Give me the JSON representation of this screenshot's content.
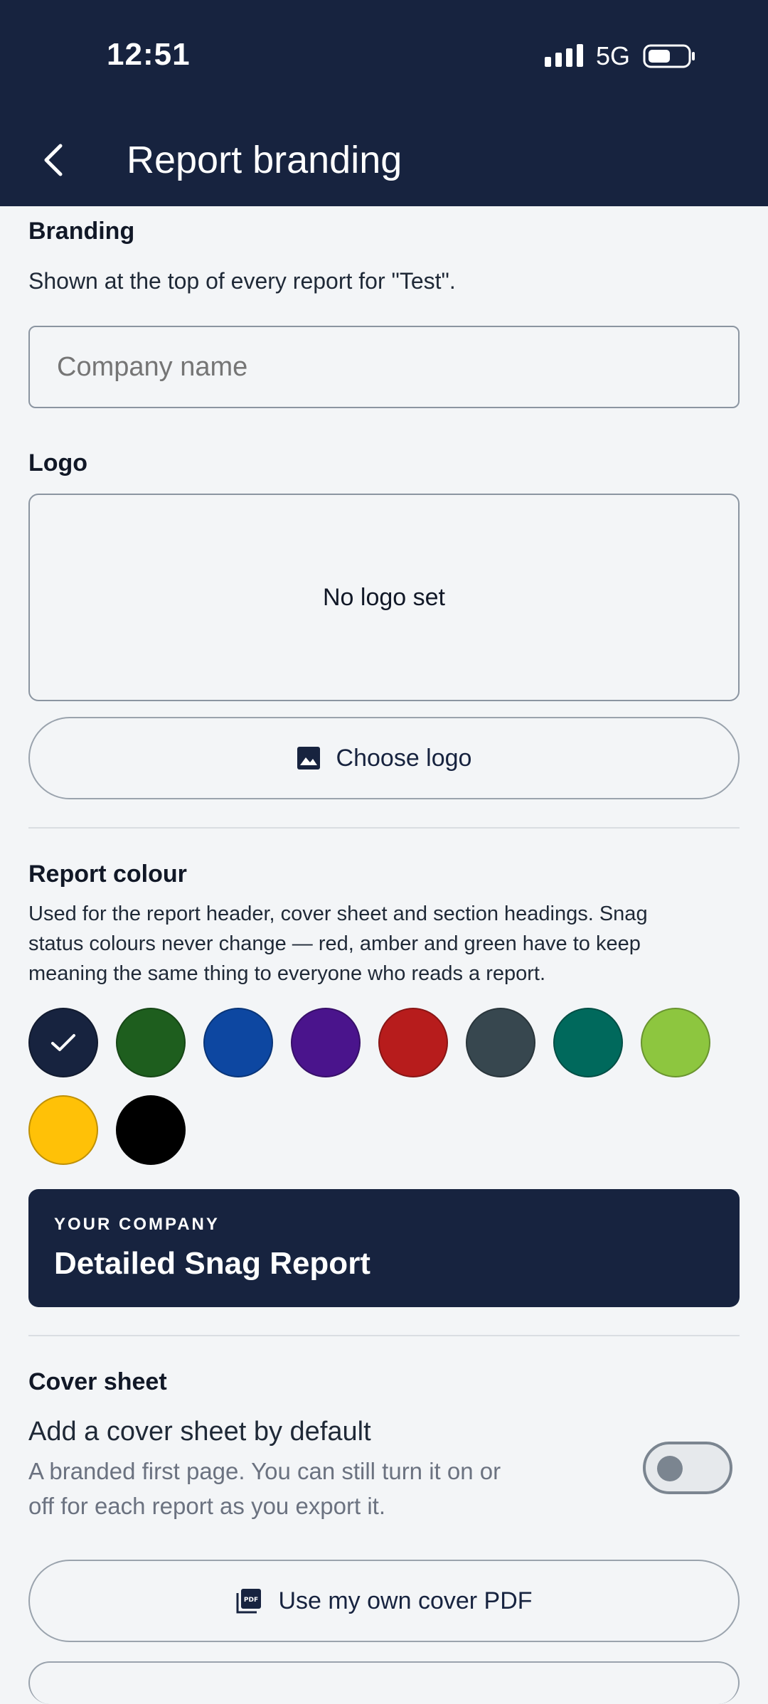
{
  "status": {
    "time": "12:51",
    "network": "5G"
  },
  "header": {
    "title": "Report branding"
  },
  "branding": {
    "heading": "Branding",
    "description": "Shown at the top of every report for \"Test\".",
    "company_placeholder": "Company name"
  },
  "logo": {
    "heading": "Logo",
    "empty_text": "No logo set",
    "choose_label": "Choose logo"
  },
  "colour": {
    "heading": "Report colour",
    "description_lines": [
      "Used for the report header, cover sheet and section headings. Snag",
      "status colours never change — red, amber and green have to keep",
      "meaning the same thing to everyone who reads a report."
    ],
    "swatches": [
      "#17233f",
      "#1e5e1e",
      "#0d47a1",
      "#4a148c",
      "#b71c1c",
      "#37474f",
      "#00695c",
      "#8dc63f",
      "#ffc107",
      "#000000"
    ],
    "selected": "#17233f"
  },
  "preview": {
    "eyebrow": "YOUR COMPANY",
    "title": "Detailed Snag Report"
  },
  "cover": {
    "heading": "Cover sheet",
    "toggle_label": "Add a cover sheet by default",
    "toggle_desc_lines": [
      "A branded first page. You can still turn it on or",
      "off for each report as you export it."
    ],
    "toggle_on": false,
    "own_pdf_label": "Use my own cover PDF"
  }
}
